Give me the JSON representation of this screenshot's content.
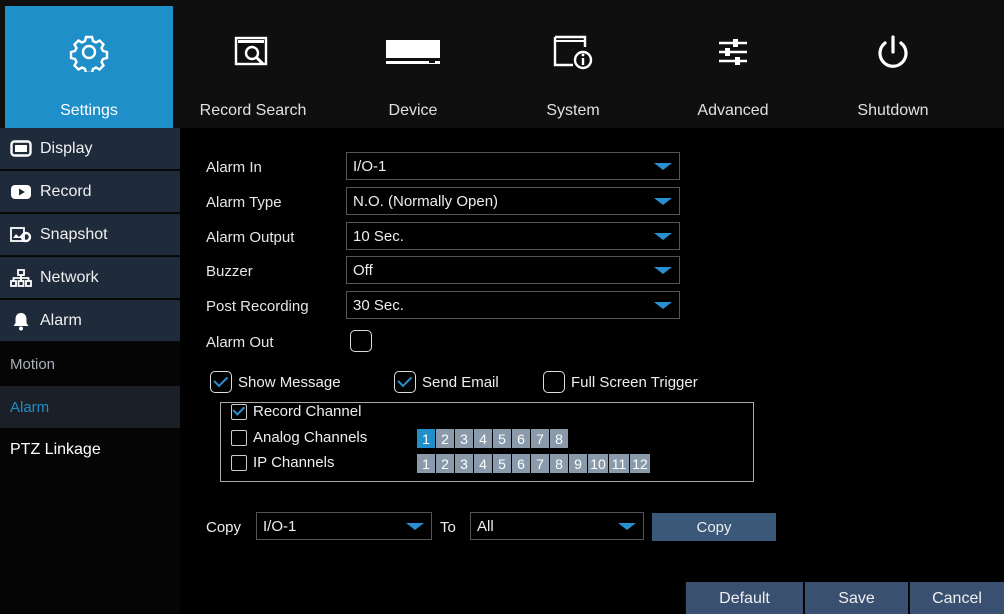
{
  "nav": {
    "settings": "Settings",
    "record_search": "Record Search",
    "device": "Device",
    "system": "System",
    "advanced": "Advanced",
    "shutdown": "Shutdown"
  },
  "sidebar": {
    "display": "Display",
    "record": "Record",
    "snapshot": "Snapshot",
    "network": "Network",
    "alarm": "Alarm",
    "motion": "Motion",
    "alarm_sub": "Alarm",
    "ptz": "PTZ Linkage"
  },
  "form": {
    "alarm_in_label": "Alarm In",
    "alarm_in_value": "I/O-1",
    "alarm_type_label": "Alarm Type",
    "alarm_type_value": "N.O. (Normally Open)",
    "alarm_output_label": "Alarm Output",
    "alarm_output_value": "10 Sec.",
    "buzzer_label": "Buzzer",
    "buzzer_value": "Off",
    "post_recording_label": "Post Recording",
    "post_recording_value": "30 Sec.",
    "alarm_out_label": "Alarm Out"
  },
  "options": {
    "show_message": "Show Message",
    "send_email": "Send Email",
    "full_screen": "Full Screen Trigger"
  },
  "record_channel": {
    "title": "Record Channel",
    "analog_label": "Analog Channels",
    "ip_label": "IP Channels",
    "analog": [
      "1",
      "2",
      "3",
      "4",
      "5",
      "6",
      "7",
      "8"
    ],
    "ip": [
      "1",
      "2",
      "3",
      "4",
      "5",
      "6",
      "7",
      "8",
      "9",
      "10",
      "11",
      "12"
    ]
  },
  "copy": {
    "label": "Copy",
    "from": "I/O-1",
    "to_label": "To",
    "to": "All",
    "button": "Copy"
  },
  "footer": {
    "default": "Default",
    "save": "Save",
    "cancel": "Cancel"
  },
  "colors": {
    "accent": "#1e8fc9",
    "button": "#3a5070"
  }
}
